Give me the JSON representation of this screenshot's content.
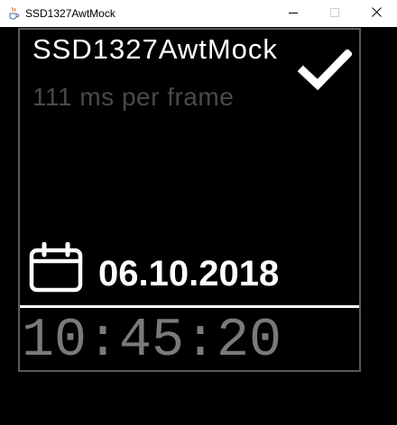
{
  "window": {
    "title": "SSD1327AwtMock",
    "icon": "java-cup-icon",
    "controls": {
      "minimize": "minimize-icon",
      "maximize": "maximize-icon",
      "close": "close-icon"
    }
  },
  "display": {
    "title": "SSD1327AwtMock",
    "frame_rate": "111 ms per frame",
    "status_icon": "checkmark-icon",
    "date_icon": "calendar-icon",
    "date": "06.10.2018",
    "time": "10:45:20"
  },
  "colors": {
    "background": "#000000",
    "foreground": "#ffffff",
    "frame_rate_text": "#4a4a4a",
    "time_text": "#7a7a7a",
    "frame_border": "#5a5a5a"
  }
}
